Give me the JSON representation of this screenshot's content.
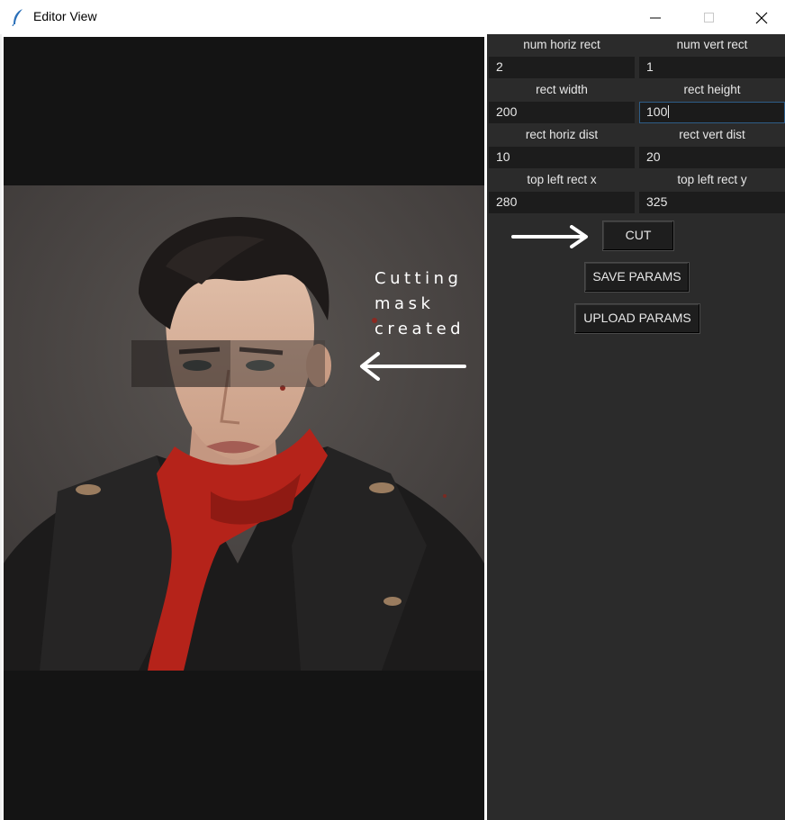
{
  "window": {
    "title": "Editor View",
    "icon": "feather-icon"
  },
  "canvas": {
    "annotation": "Cutting\nmask\ncreated"
  },
  "panel": {
    "fields": [
      {
        "label": "num horiz rect",
        "value": "2"
      },
      {
        "label": "num vert rect",
        "value": "1"
      },
      {
        "label": "rect width",
        "value": "200"
      },
      {
        "label": "rect height",
        "value": "100"
      },
      {
        "label": "rect horiz dist",
        "value": "10"
      },
      {
        "label": "rect vert dist",
        "value": "20"
      },
      {
        "label": "top left rect x",
        "value": "280"
      },
      {
        "label": "top left rect y",
        "value": "325"
      }
    ],
    "cut_label": "CUT",
    "save_label": "SAVE PARAMS",
    "upload_label": "UPLOAD PARAMS"
  },
  "colors": {
    "panel_bg": "#2b2b2b",
    "input_bg": "#1c1c1c",
    "canvas_bg": "#141414",
    "scarf": "#b5231a"
  }
}
